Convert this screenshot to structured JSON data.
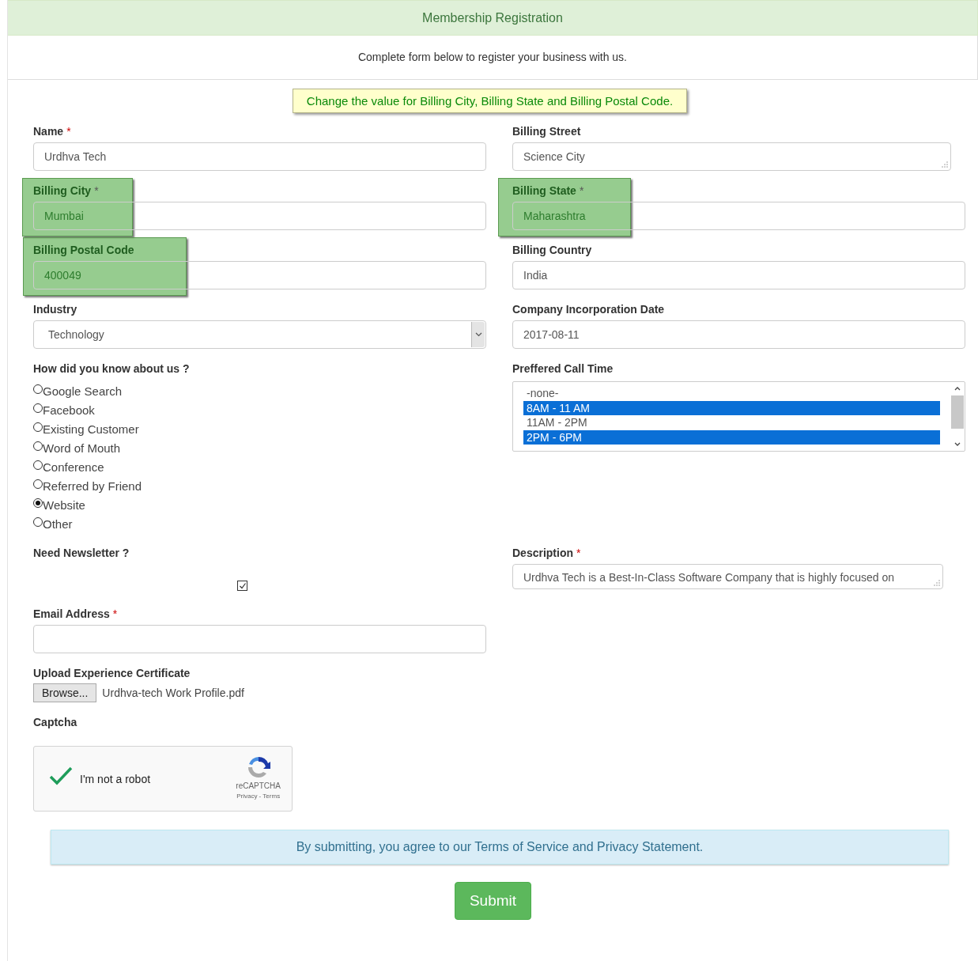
{
  "header": {
    "title": "Membership Registration",
    "subtitle": "Complete form below to register your business with us."
  },
  "notice": "Change the value for Billing City, Billing State and Billing Postal Code.",
  "rows": [
    {
      "fields": [
        {
          "kind": "text",
          "label": "Name",
          "required_mark": "*",
          "value": "Urdhva Tech"
        },
        {
          "kind": "textarea",
          "label": "Billing Street",
          "value": "Science City"
        }
      ]
    },
    {
      "fields": [
        {
          "kind": "text",
          "label": "Billing City",
          "required_mark": "*",
          "value": "Mumbai",
          "highlighted": true
        },
        {
          "kind": "text",
          "label": "Billing State",
          "required_mark": "*",
          "value": "Maharashtra",
          "highlighted": true
        }
      ]
    },
    {
      "fields": [
        {
          "kind": "text",
          "label": "Billing Postal Code",
          "value": "400049",
          "highlighted": true
        },
        {
          "kind": "text",
          "label": "Billing Country",
          "value": "India"
        }
      ]
    },
    {
      "fields": [
        {
          "kind": "select",
          "label": "Industry",
          "value": "Technology"
        },
        {
          "kind": "text",
          "label": "Company Incorporation Date",
          "value": "2017-08-11"
        }
      ]
    },
    {
      "fields": [
        {
          "kind": "radio",
          "label": "How did you know about us ?",
          "options": [
            {
              "label": "Google Search",
              "selected": false
            },
            {
              "label": "Facebook",
              "selected": false
            },
            {
              "label": "Existing Customer",
              "selected": false
            },
            {
              "label": "Word of Mouth",
              "selected": false
            },
            {
              "label": "Conference",
              "selected": false
            },
            {
              "label": "Referred by Friend",
              "selected": false
            },
            {
              "label": "Website",
              "selected": true
            },
            {
              "label": "Other",
              "selected": false
            }
          ]
        },
        {
          "kind": "listbox",
          "label": "Preffered Call Time",
          "options": [
            {
              "label": "-none-",
              "selected": false
            },
            {
              "label": "8AM - 11 AM",
              "selected": true
            },
            {
              "label": "11AM - 2PM",
              "selected": false
            },
            {
              "label": "2PM - 6PM",
              "selected": true
            }
          ]
        }
      ]
    },
    {
      "fields": [
        {
          "kind": "checkbox",
          "label": "Need Newsletter ?",
          "checked": true
        },
        {
          "kind": "textarea",
          "label": "Description",
          "required_mark": "*",
          "value": "Urdhva Tech is a Best-In-Class Software Company that is highly focused on"
        }
      ]
    },
    {
      "fields": [
        {
          "kind": "text",
          "label": "Email Address",
          "required_mark": "*"
        }
      ]
    },
    {
      "fields": [
        {
          "kind": "file",
          "label": "Upload Experience Certificate",
          "button": "Browse...",
          "filename": "Urdhva-tech Work Profile.pdf"
        }
      ]
    },
    {
      "fields": [
        {
          "kind": "captcha",
          "label": "Captcha",
          "checked": true,
          "text": "I'm not a robot",
          "brand": "reCAPTCHA",
          "links": "Privacy - Terms"
        }
      ]
    }
  ],
  "agreement": "By submitting, you agree to our Terms of Service and Privacy Statement.",
  "submit": "Submit"
}
